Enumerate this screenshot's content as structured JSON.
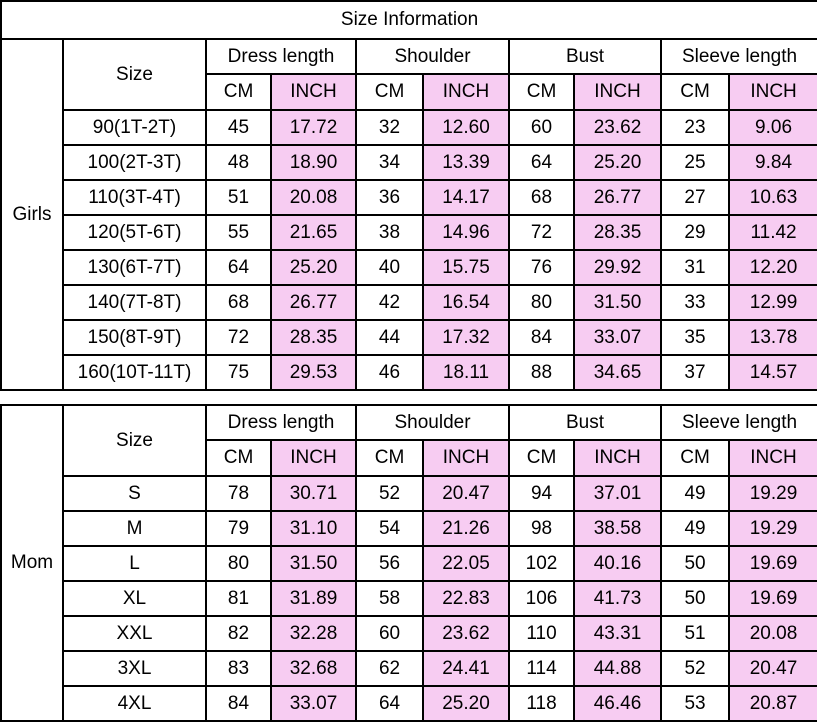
{
  "title": "Size Information",
  "columns": {
    "size_header": "Size",
    "measures": [
      "Dress length",
      "Shoulder",
      "Bust",
      "Sleeve length"
    ],
    "units": [
      "CM",
      "INCH"
    ]
  },
  "colors": {
    "inch_highlight": "#f7ccf2",
    "border": "#000000",
    "background": "#ffffff",
    "text": "#000000"
  },
  "tables": [
    {
      "group_label": "Girls",
      "rows": [
        {
          "size": "90(1T-2T)",
          "dress_cm": "45",
          "dress_in": "17.72",
          "shoulder_cm": "32",
          "shoulder_in": "12.60",
          "bust_cm": "60",
          "bust_in": "23.62",
          "sleeve_cm": "23",
          "sleeve_in": "9.06"
        },
        {
          "size": "100(2T-3T)",
          "dress_cm": "48",
          "dress_in": "18.90",
          "shoulder_cm": "34",
          "shoulder_in": "13.39",
          "bust_cm": "64",
          "bust_in": "25.20",
          "sleeve_cm": "25",
          "sleeve_in": "9.84"
        },
        {
          "size": "110(3T-4T)",
          "dress_cm": "51",
          "dress_in": "20.08",
          "shoulder_cm": "36",
          "shoulder_in": "14.17",
          "bust_cm": "68",
          "bust_in": "26.77",
          "sleeve_cm": "27",
          "sleeve_in": "10.63"
        },
        {
          "size": "120(5T-6T)",
          "dress_cm": "55",
          "dress_in": "21.65",
          "shoulder_cm": "38",
          "shoulder_in": "14.96",
          "bust_cm": "72",
          "bust_in": "28.35",
          "sleeve_cm": "29",
          "sleeve_in": "11.42"
        },
        {
          "size": "130(6T-7T)",
          "dress_cm": "64",
          "dress_in": "25.20",
          "shoulder_cm": "40",
          "shoulder_in": "15.75",
          "bust_cm": "76",
          "bust_in": "29.92",
          "sleeve_cm": "31",
          "sleeve_in": "12.20"
        },
        {
          "size": "140(7T-8T)",
          "dress_cm": "68",
          "dress_in": "26.77",
          "shoulder_cm": "42",
          "shoulder_in": "16.54",
          "bust_cm": "80",
          "bust_in": "31.50",
          "sleeve_cm": "33",
          "sleeve_in": "12.99"
        },
        {
          "size": "150(8T-9T)",
          "dress_cm": "72",
          "dress_in": "28.35",
          "shoulder_cm": "44",
          "shoulder_in": "17.32",
          "bust_cm": "84",
          "bust_in": "33.07",
          "sleeve_cm": "35",
          "sleeve_in": "13.78"
        },
        {
          "size": "160(10T-11T)",
          "dress_cm": "75",
          "dress_in": "29.53",
          "shoulder_cm": "46",
          "shoulder_in": "18.11",
          "bust_cm": "88",
          "bust_in": "34.65",
          "sleeve_cm": "37",
          "sleeve_in": "14.57"
        }
      ]
    },
    {
      "group_label": "Mom",
      "rows": [
        {
          "size": "S",
          "dress_cm": "78",
          "dress_in": "30.71",
          "shoulder_cm": "52",
          "shoulder_in": "20.47",
          "bust_cm": "94",
          "bust_in": "37.01",
          "sleeve_cm": "49",
          "sleeve_in": "19.29"
        },
        {
          "size": "M",
          "dress_cm": "79",
          "dress_in": "31.10",
          "shoulder_cm": "54",
          "shoulder_in": "21.26",
          "bust_cm": "98",
          "bust_in": "38.58",
          "sleeve_cm": "49",
          "sleeve_in": "19.29"
        },
        {
          "size": "L",
          "dress_cm": "80",
          "dress_in": "31.50",
          "shoulder_cm": "56",
          "shoulder_in": "22.05",
          "bust_cm": "102",
          "bust_in": "40.16",
          "sleeve_cm": "50",
          "sleeve_in": "19.69"
        },
        {
          "size": "XL",
          "dress_cm": "81",
          "dress_in": "31.89",
          "shoulder_cm": "58",
          "shoulder_in": "22.83",
          "bust_cm": "106",
          "bust_in": "41.73",
          "sleeve_cm": "50",
          "sleeve_in": "19.69"
        },
        {
          "size": "XXL",
          "dress_cm": "82",
          "dress_in": "32.28",
          "shoulder_cm": "60",
          "shoulder_in": "23.62",
          "bust_cm": "110",
          "bust_in": "43.31",
          "sleeve_cm": "51",
          "sleeve_in": "20.08"
        },
        {
          "size": "3XL",
          "dress_cm": "83",
          "dress_in": "32.68",
          "shoulder_cm": "62",
          "shoulder_in": "24.41",
          "bust_cm": "114",
          "bust_in": "44.88",
          "sleeve_cm": "52",
          "sleeve_in": "20.47"
        },
        {
          "size": "4XL",
          "dress_cm": "84",
          "dress_in": "33.07",
          "shoulder_cm": "64",
          "shoulder_in": "25.20",
          "bust_cm": "118",
          "bust_in": "46.46",
          "sleeve_cm": "53",
          "sleeve_in": "20.87"
        }
      ]
    }
  ]
}
